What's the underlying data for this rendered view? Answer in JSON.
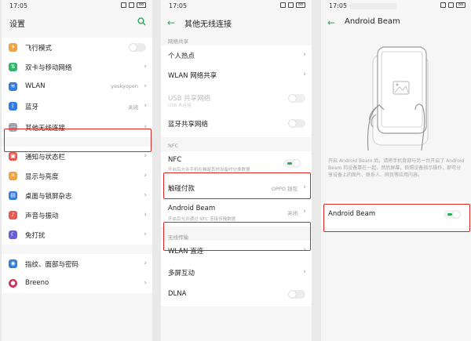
{
  "status_time": "17:05",
  "battery": "88",
  "panel1": {
    "title": "设置",
    "items": [
      {
        "label": "飞行模式"
      },
      {
        "label": "双卡与移动网络"
      },
      {
        "label": "WLAN",
        "value": "yeskyopen"
      },
      {
        "label": "蓝牙",
        "value": "关闭"
      },
      {
        "label": "其他无线连接"
      },
      {
        "label": "通知与状态栏"
      },
      {
        "label": "显示与亮度"
      },
      {
        "label": "桌面与锁屏杂志"
      },
      {
        "label": "声音与振动"
      },
      {
        "label": "免打扰"
      },
      {
        "label": "指纹、面部与密码"
      },
      {
        "label": "Breeno"
      }
    ]
  },
  "panel2": {
    "title": "其他无线连接",
    "sections": {
      "share": "网络共享",
      "nfc": "NFC",
      "wireless": "无线传输"
    },
    "items": {
      "hotspot": "个人热点",
      "wlan_share": "WLAN 网络共享",
      "usb_share": "USB 共享网络",
      "usb_sub": "USB 未连接",
      "bt_share": "蓝牙共享网络",
      "nfc": "NFC",
      "nfc_sub": "开启后允许手机在触碰其他设备时交换数据",
      "tap_pay": "触碰付款",
      "tap_pay_value": "OPPO 钱包",
      "beam": "Android Beam",
      "beam_value": "关闭",
      "beam_sub": "开启后允许通过 NFC 连接传输数据",
      "wlan_direct": "WLAN 直连",
      "multiscreen": "多屏互动",
      "dlna": "DLNA"
    }
  },
  "panel3": {
    "title": "Android Beam",
    "description": "开启 Android Beam 后，请将手机背部与另一台开启了 Android Beam 的设备靠在一起，然后屏幕，依照设备指示操作，即可分享设备上的图片、联系人、网页等应用内容。",
    "toggle_label": "Android Beam"
  },
  "colors": {
    "accent": "#2aa85c",
    "highlight": "#d22222"
  }
}
